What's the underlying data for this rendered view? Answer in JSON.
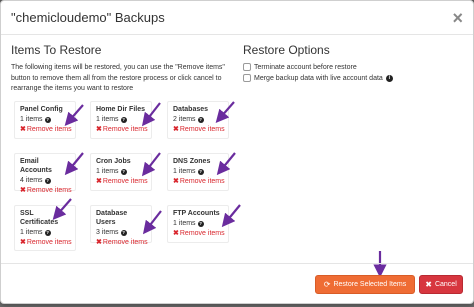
{
  "modal": {
    "title": "\"chemicloudemo\" Backups",
    "close_glyph": "×"
  },
  "left": {
    "heading": "Items To Restore",
    "intro": "The following items will be restored, you can use the \"Remove items\" button to remove them all from the restore process or click cancel to rearrange the items you want to restore"
  },
  "right": {
    "heading": "Restore Options",
    "options": [
      {
        "label": "Terminate account before restore",
        "checked": false,
        "info": false
      },
      {
        "label": "Merge backup data with live account data",
        "checked": false,
        "info": true
      }
    ]
  },
  "tiles": [
    {
      "name": "Panel Config",
      "count": "1 items",
      "remove": "Remove items"
    },
    {
      "name": "Home Dir Files",
      "count": "1 items",
      "remove": "Remove items"
    },
    {
      "name": "Databases",
      "count": "2 items",
      "remove": "Remove items"
    },
    {
      "name": "Email Accounts",
      "count": "4 items",
      "remove": "Remove items"
    },
    {
      "name": "Cron Jobs",
      "count": "1 items",
      "remove": "Remove items"
    },
    {
      "name": "DNS Zones",
      "count": "1 items",
      "remove": "Remove items"
    },
    {
      "name": "SSL Certificates",
      "count": "1 items",
      "remove": "Remove items"
    },
    {
      "name": "Database Users",
      "count": "3 items",
      "remove": "Remove items"
    },
    {
      "name": "FTP Accounts",
      "count": "1 items",
      "remove": "Remove items"
    }
  ],
  "footer": {
    "restore_label": "Restore Selected Items",
    "cancel_label": "Cancel"
  },
  "colors": {
    "restore_button": "#ef6c34",
    "cancel_button": "#d7363f",
    "remove_link": "#d9272e",
    "annotation_arrow": "#6a2c9e"
  }
}
